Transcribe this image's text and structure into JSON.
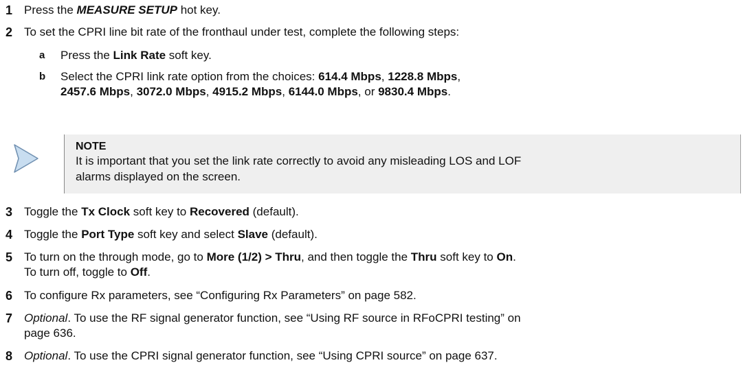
{
  "steps": [
    {
      "num": "1",
      "parts": [
        "Press the ",
        "MEASURE SETUP",
        " hot key."
      ]
    },
    {
      "num": "2",
      "text": "To set the CPRI line bit rate of the fronthaul under test, complete the following steps:"
    },
    {
      "num": "3",
      "parts": [
        "Toggle the ",
        "Tx Clock",
        " soft key to ",
        "Recovered",
        " (default)."
      ]
    },
    {
      "num": "4",
      "parts": [
        "Toggle the ",
        "Port Type",
        " soft key and select ",
        "Slave",
        " (default)."
      ]
    },
    {
      "num": "5",
      "parts": [
        "To turn on the through mode, go to ",
        "More (1/2) > Thru",
        ", and then toggle the ",
        "Thru",
        " soft key to ",
        "On",
        "."
      ],
      "line2": [
        "To turn off, toggle to ",
        "Off",
        "."
      ]
    },
    {
      "num": "6",
      "text": "To configure Rx parameters, see “Configuring Rx Parameters” on page 582."
    },
    {
      "num": "7",
      "parts": [
        "Optional",
        ". To use the RF signal generator function, see “Using RF source in RFoCPRI testing” on"
      ],
      "line2": "page 636."
    },
    {
      "num": "8",
      "parts": [
        "Optional",
        ". To use the CPRI signal generator function, see “Using CPRI source” on page 637."
      ]
    }
  ],
  "substeps": [
    {
      "letter": "a",
      "parts": [
        "Press the ",
        "Link Rate",
        " soft key."
      ]
    },
    {
      "letter": "b",
      "line1": "Select the CPRI link rate option from the choices: ",
      "rates": [
        "614.4 Mbps",
        "1228.8 Mbps",
        "2457.6 Mbps",
        "3072.0 Mbps",
        "4915.2 Mbps",
        "6144.0 Mbps",
        "9830.4 Mbps"
      ],
      "sep": ", ",
      "or": ", or ",
      "end": "."
    }
  ],
  "note": {
    "title": "NOTE",
    "line1": "It is important that you set the link rate correctly to avoid any misleading LOS and LOF",
    "line2": "alarms displayed on the screen.",
    "icon": "note-arrow-icon"
  },
  "colors": {
    "note_bg": "#efefef",
    "icon_fill": "#c8ddf0",
    "icon_stroke": "#6f8fb0"
  }
}
